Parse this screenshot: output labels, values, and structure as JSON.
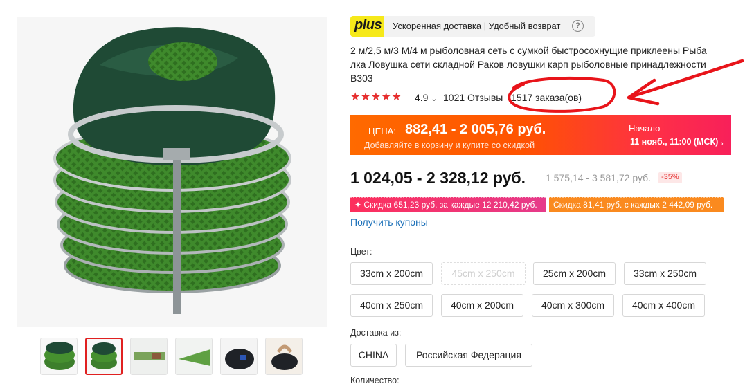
{
  "plus_bar": {
    "logo": "plus",
    "text": "Ускоренная доставка | Удобный возврат",
    "help": "?"
  },
  "product": {
    "title_lines": [
      "2 м/2,5 м/3 М/4 м рыболовная сеть с сумкой быстросохнущие приклеены Рыба",
      "лка Ловушка сети складной Раков ловушки карп рыболовные принадлежности",
      "B303"
    ],
    "stars": "★★★★★",
    "rating": "4.9",
    "rating_chevron": "⌄",
    "reviews": "1021 Отзывы",
    "orders": "1517 заказа(ов)"
  },
  "sale_banner": {
    "label": "ЦЕНА:",
    "price": "882,41 - 2 005,76 руб.",
    "subtext": "Добавляйте в корзину и купите со скидкой",
    "start_label": "Начало",
    "start_date": "11 нояб., 11:00 (МСК)",
    "chevron": "›"
  },
  "price": {
    "current": "1 024,05 - 2 328,12 руб.",
    "old": "1 575,14 - 3 581,72 руб.",
    "discount": "-35%"
  },
  "coupons": {
    "a": "✦ Скидка 651,23 руб. за каждые 12 210,42 руб.",
    "b": "Скидка 81,41 руб. с каждых 2 442,09 руб.",
    "get_coupons": "Получить купоны"
  },
  "color": {
    "label": "Цвет:",
    "options": [
      "33cm x 200cm",
      "45cm x 250cm",
      "25cm x 200cm",
      "33cm x 250cm",
      "40cm x 250cm",
      "40cm x 200cm",
      "40cm x 300cm",
      "40cm x 400cm"
    ],
    "disabled_option": "45cm x 250cm"
  },
  "delivery": {
    "label": "Доставка из:",
    "options": [
      "CHINA",
      "Российская Федерация"
    ]
  },
  "quantity": {
    "label": "Количество:"
  },
  "colors": {
    "accent_red": "#e62e2e",
    "link_blue": "#1a6fb8",
    "plus_yellow": "#f6e91a",
    "banner_orange": "#ff5a00",
    "banner_pink": "#f8205a",
    "annotation_red": "#e8141a"
  },
  "icons": [
    "star-icon",
    "help-icon",
    "chevron-down-icon",
    "chevron-right-icon"
  ],
  "gallery": {
    "thumbnail_count": 6,
    "selected_thumbnail": 2
  }
}
